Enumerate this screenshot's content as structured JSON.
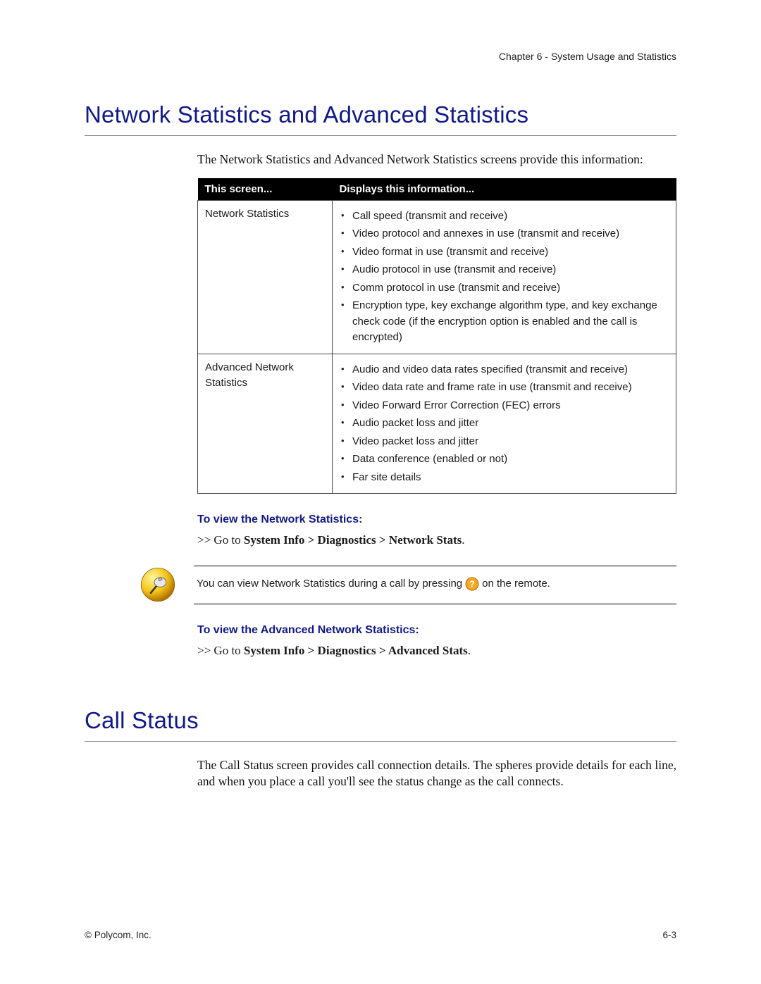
{
  "running_header": "Chapter 6 - System Usage and Statistics",
  "section1": {
    "title": "Network Statistics and Advanced Statistics",
    "intro": "The Network Statistics and Advanced Network Statistics screens provide this information:",
    "table": {
      "head": {
        "col1": "This screen...",
        "col2": "Displays this information..."
      },
      "rows": [
        {
          "label": "Network Statistics",
          "items": [
            "Call speed (transmit and receive)",
            "Video protocol and annexes in use (transmit and receive)",
            "Video format in use (transmit and receive)",
            "Audio protocol in use (transmit and receive)",
            "Comm protocol in use (transmit and receive)",
            "Encryption type, key exchange algorithm type, and key exchange check code (if the encryption option is enabled and the call is encrypted)"
          ]
        },
        {
          "label": "Advanced Network Statistics",
          "items": [
            "Audio and video data rates specified (transmit and receive)",
            "Video data rate and frame rate in use (transmit and receive)",
            "Video Forward Error Correction (FEC) errors",
            "Audio packet loss and jitter",
            "Video packet loss and jitter",
            "Data conference (enabled or not)",
            "Far site details"
          ]
        }
      ]
    },
    "sub1": {
      "heading": "To view the Network Statistics:",
      "step_prefix": ">> Go to ",
      "step_bold": "System Info > Diagnostics > Network Stats",
      "step_suffix": "."
    },
    "note": {
      "pre": "You can view Network Statistics during a call by pressing ",
      "post": " on the remote."
    },
    "sub2": {
      "heading": "To view the Advanced Network Statistics:",
      "step_prefix": ">> Go to ",
      "step_bold": "System Info > Diagnostics > Advanced Stats",
      "step_suffix": "."
    }
  },
  "section2": {
    "title": "Call Status",
    "body": "The Call Status screen provides call connection details. The spheres provide details for each line, and when you place a call you'll see the status change as the call connects."
  },
  "footer": {
    "left": "© Polycom, Inc.",
    "right": "6-3"
  }
}
